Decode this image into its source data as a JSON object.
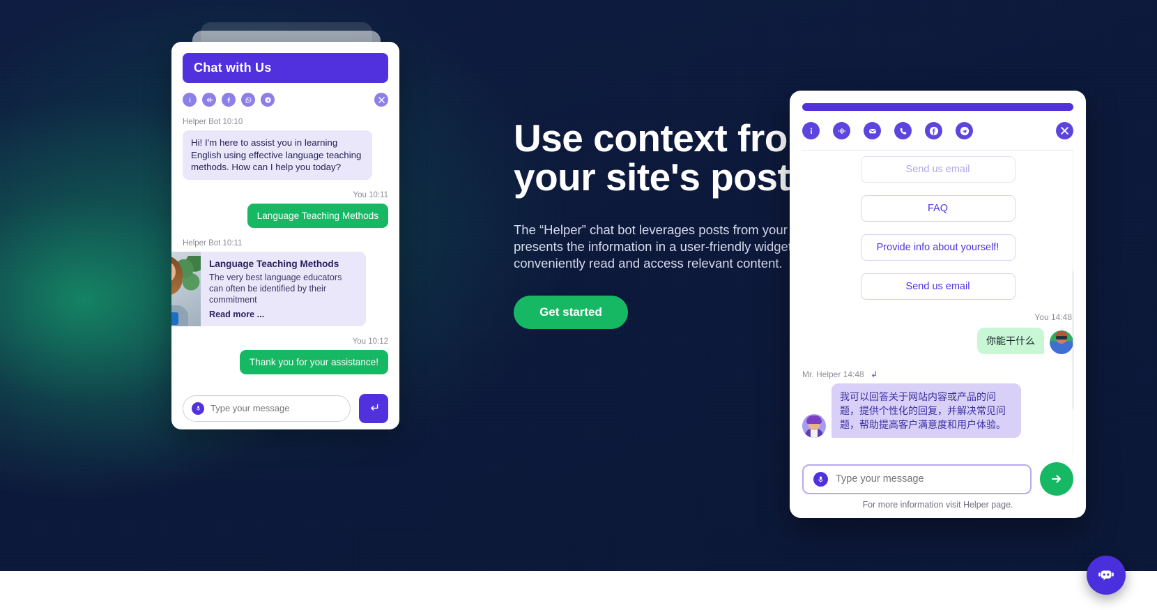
{
  "hero": {
    "headline_line1": "Use context from",
    "headline_line2": "your site's posts",
    "paragraph": "The “Helper” chat bot leverages posts from your website and presents the information in a user-friendly widget, allowing users to conveniently read and access relevant content.",
    "cta_label": "Get started"
  },
  "left_widget": {
    "header_title": "Chat with Us",
    "icons": [
      "info-icon",
      "sound-icon",
      "facebook-icon",
      "whatsapp-icon",
      "telegram-icon"
    ],
    "close_icon": "close-icon",
    "messages": [
      {
        "meta": "Helper Bot 10:10",
        "side": "bot",
        "text": "Hi! I'm here to assist you in learning English using effective language teaching methods. How can I help you today?"
      },
      {
        "meta": "You 10:11",
        "side": "user",
        "text": "Language Teaching Methods"
      },
      {
        "meta": "Helper Bot 10:11",
        "side": "card",
        "card_title": "Language Teaching Methods",
        "card_text": "The very best language educators can often be identified by their commitment",
        "card_link": "Read more ..."
      },
      {
        "meta": "You 10:12",
        "side": "user",
        "text": "Thank you for your assistance!"
      }
    ],
    "input_placeholder": "Type your message",
    "send_icon": "enter-arrow-icon",
    "mic_icon": "microphone-icon"
  },
  "right_widget": {
    "icons": [
      "info-icon",
      "voice-waveform-icon",
      "email-icon",
      "phone-icon",
      "facebook-icon",
      "telegram-icon"
    ],
    "close_icon": "close-icon",
    "options": [
      {
        "label": "Send us email",
        "faded": true
      },
      {
        "label": "FAQ",
        "faded": false
      },
      {
        "label": "Provide info about yourself!",
        "faded": false
      },
      {
        "label": "Send us email",
        "faded": false
      }
    ],
    "messages": [
      {
        "meta": "You 14:48",
        "side": "user",
        "text": "你能干什么"
      },
      {
        "meta": "Mr. Helper 14:48",
        "side": "bot",
        "reply_icon": "reply-arrow-icon",
        "text": "我可以回答关于网站内容或产品的问题，提供个性化的回复，并解决常见问题，帮助提高客户满意度和用户体验。"
      }
    ],
    "input_placeholder": "Type your message",
    "send_icon": "send-arrow-icon",
    "mic_icon": "microphone-icon",
    "footer": "For more information visit Helper page."
  },
  "fab": {
    "icon": "chat-bot-icon"
  },
  "colors": {
    "primary_purple": "#5031dd",
    "accent_green": "#17b864",
    "background_navy": "#0d1b3e",
    "bot_bubble": "#ebe7fb",
    "user_bubble_green": "#c9f7d5"
  }
}
